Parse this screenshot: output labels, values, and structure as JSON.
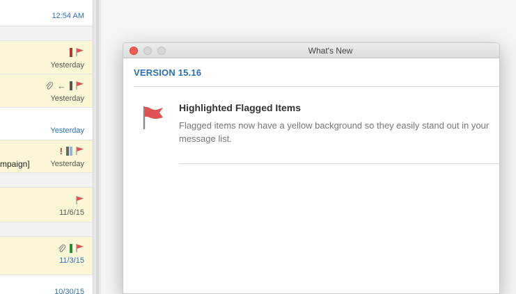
{
  "message_list": {
    "rows": [
      {
        "time": "12:54 AM"
      },
      {
        "time": "Yesterday"
      },
      {
        "time": "Yesterday"
      },
      {
        "time": "Yesterday"
      },
      {
        "subject_fragment": "mpaign]",
        "time": "Yesterday"
      },
      {
        "time": "11/6/15"
      },
      {
        "time": "11/3/15"
      },
      {
        "time": "10/30/15"
      }
    ]
  },
  "dialog": {
    "title": "What's New",
    "version": "VERSION 15.16",
    "feature": {
      "title": "Highlighted Flagged Items",
      "description": "Flagged items now have a yellow background so they easily stand out in your message list.",
      "icon": "flag-icon"
    }
  },
  "colors": {
    "flagged_row_bg": "#fbf7d6",
    "accent_blue": "#2a6fb6",
    "flag_red": "#e05252"
  }
}
